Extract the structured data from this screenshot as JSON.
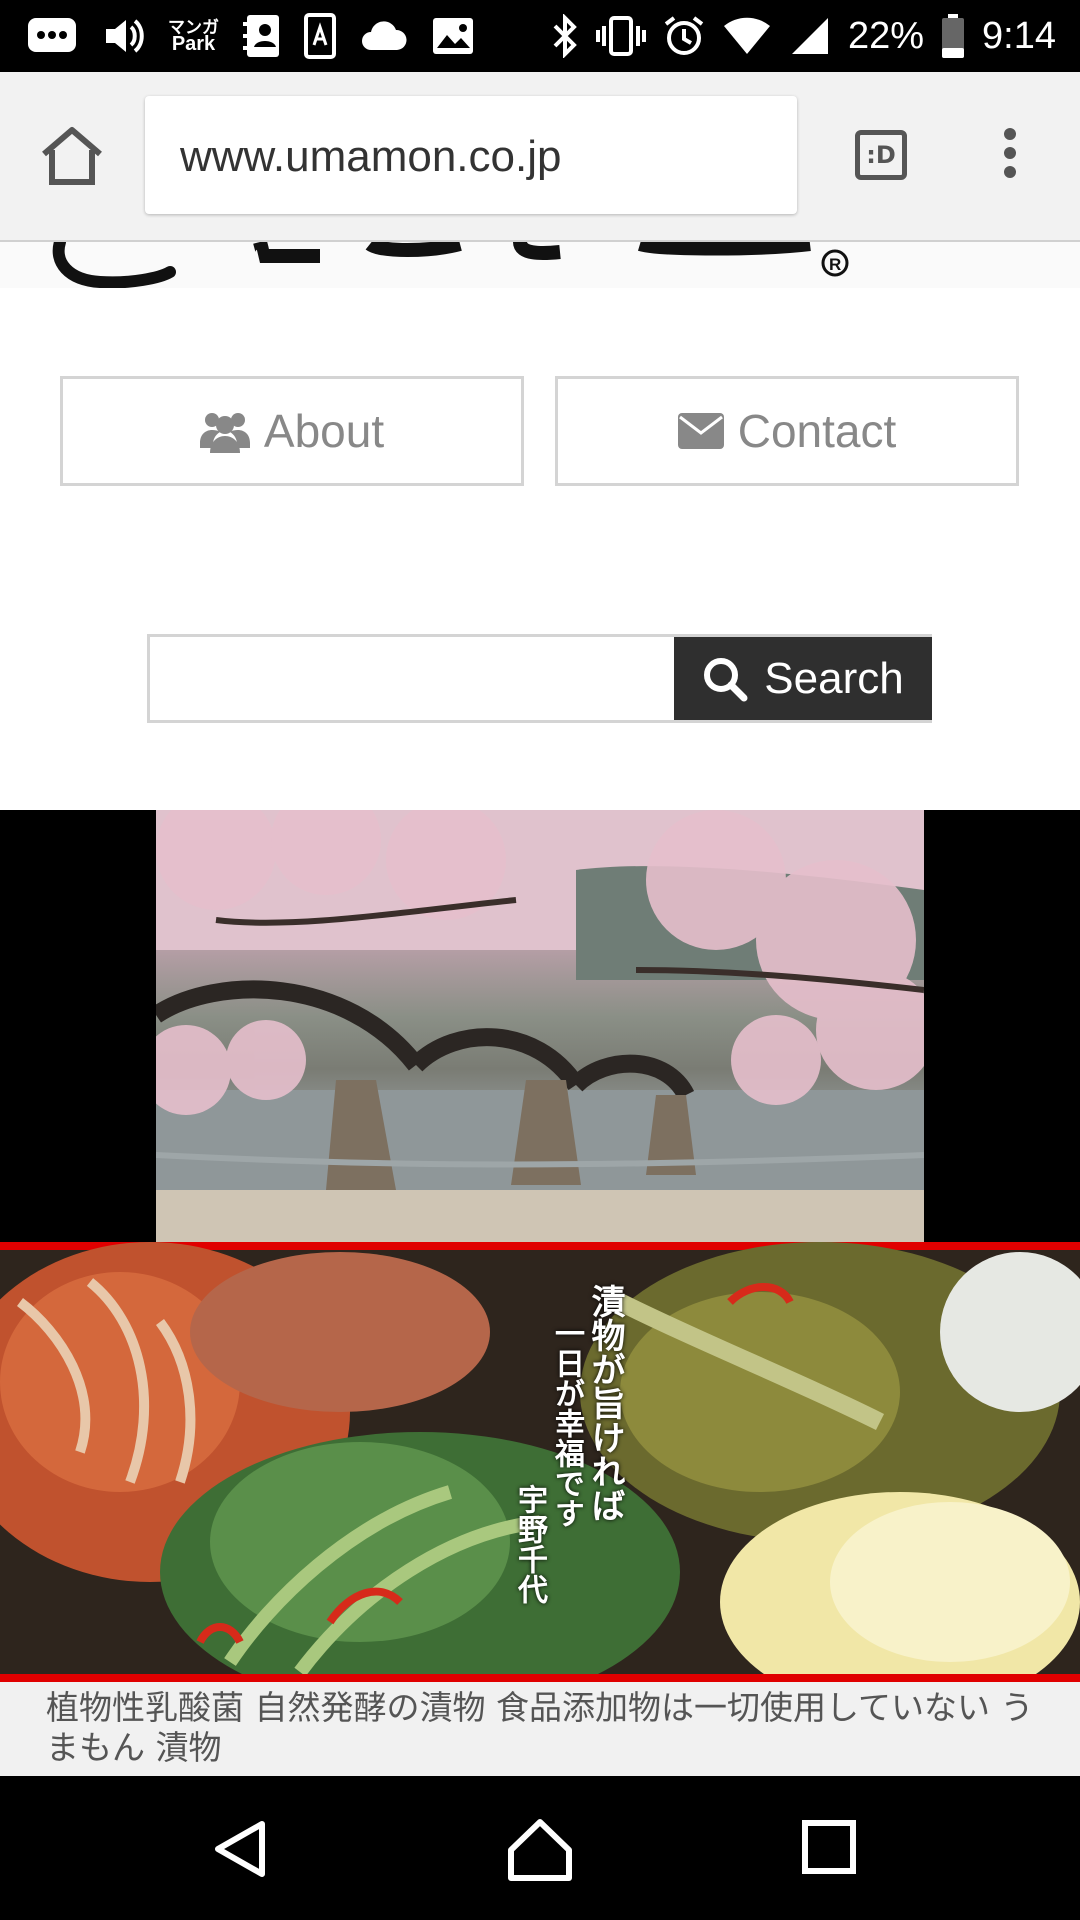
{
  "status_bar": {
    "left_icons": [
      "message-icon",
      "volume-icon",
      "manga-park-icon",
      "contacts-icon",
      "font-app-icon",
      "cloud-icon",
      "gallery-icon"
    ],
    "manga_park_line1": "マンガ",
    "manga_park_line2": "Park",
    "right_icons": [
      "bluetooth-icon",
      "vibrate-icon",
      "alarm-icon",
      "wifi-icon",
      "signal-icon",
      "battery-icon"
    ],
    "battery": "22%",
    "time": "9:14"
  },
  "browser": {
    "url": "www.umamon.co.jp",
    "tabs_label": ":D"
  },
  "nav": {
    "about_label": "About",
    "contact_label": "Contact"
  },
  "search": {
    "button_label": "Search",
    "value": ""
  },
  "banner_poem": {
    "line1": "漬物が旨ければ",
    "line2": "一日が幸福です",
    "author": "宇野千代"
  },
  "caption": "植物性乳酸菌 自然発酵の漬物 食品添加物は一切使用していない うまもん 漬物",
  "colors": {
    "search_button_bg": "#2f2f2f",
    "banner_border": "#e00000",
    "nav_text": "#888888"
  }
}
